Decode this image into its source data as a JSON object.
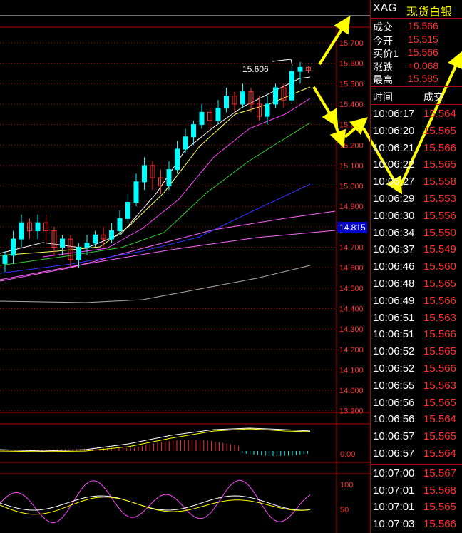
{
  "symbol": {
    "code": "XAG",
    "name": "现货白银"
  },
  "quote": [
    {
      "label": "成交",
      "value": "15.566"
    },
    {
      "label": "今开",
      "value": "15.515"
    },
    {
      "label": "买价1",
      "value": "15.566"
    },
    {
      "label": "涨跌",
      "value": "+0.068"
    },
    {
      "label": "最高",
      "value": "15.585"
    }
  ],
  "ticks_header": {
    "time": "时间",
    "price": "成交"
  },
  "ticks": [
    {
      "time": "10:06:17",
      "price": "15.564"
    },
    {
      "time": "10:06:20",
      "price": "15.565"
    },
    {
      "time": "10:06:21",
      "price": "15.566"
    },
    {
      "time": "10:06:22",
      "price": "15.565"
    },
    {
      "time": "10:06:27",
      "price": "15.558"
    },
    {
      "time": "10:06:29",
      "price": "15.553"
    },
    {
      "time": "10:06:30",
      "price": "15.556"
    },
    {
      "time": "10:06:34",
      "price": "15.550"
    },
    {
      "time": "10:06:37",
      "price": "15.549"
    },
    {
      "time": "10:06:46",
      "price": "15.560"
    },
    {
      "time": "10:06:48",
      "price": "15.565"
    },
    {
      "time": "10:06:49",
      "price": "15.566"
    },
    {
      "time": "10:06:51",
      "price": "15.563"
    },
    {
      "time": "10:06:51",
      "price": "15.566"
    },
    {
      "time": "10:06:52",
      "price": "15.565"
    },
    {
      "time": "10:06:52",
      "price": "15.566"
    },
    {
      "time": "10:06:55",
      "price": "15.563"
    },
    {
      "time": "10:06:56",
      "price": "15.565"
    },
    {
      "time": "10:06:56",
      "price": "15.564"
    },
    {
      "time": "10:06:57",
      "price": "15.565"
    },
    {
      "time": "10:06:57",
      "price": "15.564"
    },
    {
      "time": "10:07:00",
      "price": "15.567"
    },
    {
      "time": "10:07:01",
      "price": "15.568"
    },
    {
      "time": "10:07:01",
      "price": "15.565"
    },
    {
      "time": "10:07:03",
      "price": "15.566"
    }
  ],
  "chart": {
    "price_axis": [
      "15.700",
      "15.600",
      "15.500",
      "15.400",
      "15.300",
      "15.200",
      "15.100",
      "15.000",
      "14.900",
      "14.800",
      "14.700",
      "14.600",
      "14.500",
      "14.400",
      "14.300",
      "14.200",
      "14.100",
      "14.000",
      "13.900"
    ],
    "current_price_tag": "14.815",
    "high_marker": "15.606",
    "macd_axis": [
      "0.00"
    ],
    "kdj_axis": [
      "100",
      "50"
    ],
    "colors": {
      "up": "#00ffff",
      "down": "#ff3030",
      "grid": "#b00000",
      "axis": "#ff3030",
      "annotation": "#ffff00"
    }
  }
}
